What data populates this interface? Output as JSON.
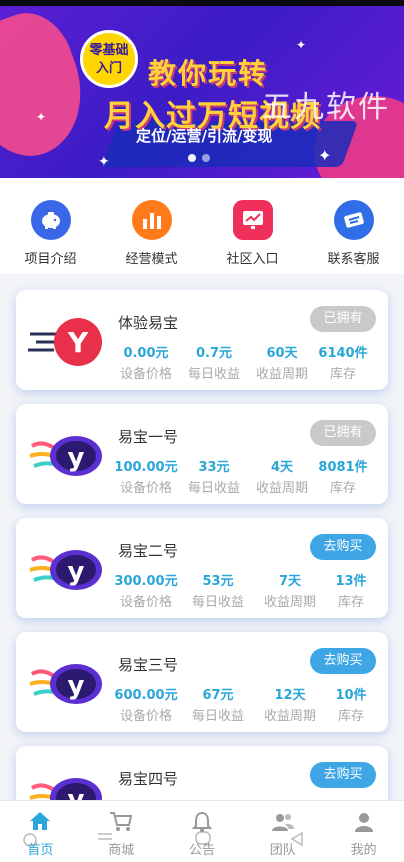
{
  "banner": {
    "badge_line1": "零基础",
    "badge_line2": "入门",
    "title1": "教你玩转",
    "title2": "月入过万短视频",
    "subtitle": "定位/运营/引流/变现",
    "watermark": "五九软件"
  },
  "quick_menu": [
    {
      "label": "项目介绍",
      "icon": "piggy-bank-icon",
      "color": "#3a66e8"
    },
    {
      "label": "经营模式",
      "icon": "bar-chart-icon",
      "color": "#ff7a1a"
    },
    {
      "label": "社区入口",
      "icon": "trend-monitor-icon",
      "color": "#f0305a"
    },
    {
      "label": "联系客服",
      "icon": "ticket-icon",
      "color": "#2f6ee6"
    }
  ],
  "stat_labels": {
    "price": "设备价格",
    "daily": "每日收益",
    "period": "收益周期",
    "stock": "库存"
  },
  "products": [
    {
      "name": "体验易宝",
      "button": "已拥有",
      "owned": true,
      "price": "0.00元",
      "daily": "0.7元",
      "period": "60天",
      "stock": "6140件"
    },
    {
      "name": "易宝一号",
      "button": "已拥有",
      "owned": true,
      "price": "100.00元",
      "daily": "33元",
      "period": "4天",
      "stock": "8081件"
    },
    {
      "name": "易宝二号",
      "button": "去购买",
      "owned": false,
      "price": "300.00元",
      "daily": "53元",
      "period": "7天",
      "stock": "13件"
    },
    {
      "name": "易宝三号",
      "button": "去购买",
      "owned": false,
      "price": "600.00元",
      "daily": "67元",
      "period": "12天",
      "stock": "10件"
    },
    {
      "name": "易宝四号",
      "button": "去购买",
      "owned": false,
      "price": "",
      "daily": "",
      "period": "",
      "stock": ""
    }
  ],
  "tabs": [
    {
      "label": "首页",
      "icon": "home-icon",
      "active": true
    },
    {
      "label": "商城",
      "icon": "cart-icon",
      "active": false
    },
    {
      "label": "公告",
      "icon": "bell-icon",
      "active": false
    },
    {
      "label": "团队",
      "icon": "team-icon",
      "active": false
    },
    {
      "label": "我的",
      "icon": "user-icon",
      "active": false
    }
  ],
  "colors": {
    "accent": "#2aa6d9",
    "buy_button": "#3fa6e6",
    "owned_button": "#c9c9c9"
  }
}
